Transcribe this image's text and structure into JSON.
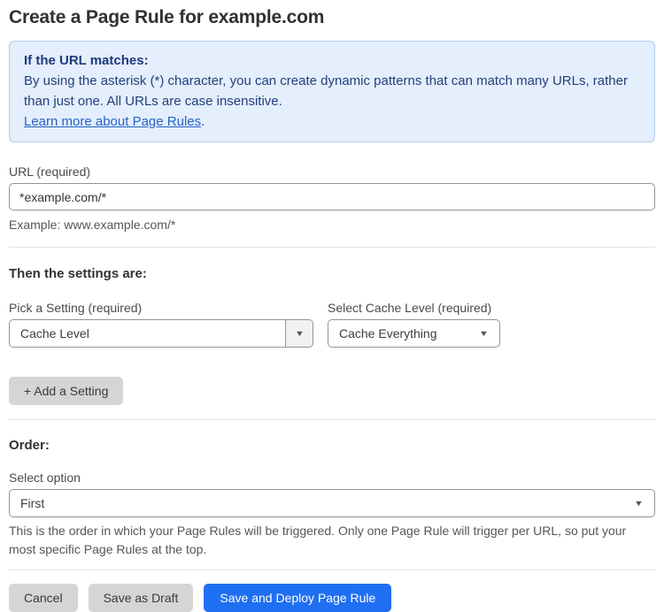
{
  "page": {
    "title": "Create a Page Rule for example.com"
  },
  "info_box": {
    "heading": "If the URL matches:",
    "body": "By using the asterisk (*) character, you can create dynamic patterns that can match many URLs, rather than just one. All URLs are case insensitive.",
    "link_label": "Learn more about Page Rules",
    "link_suffix": "."
  },
  "url_field": {
    "label": "URL (required)",
    "value": "*example.com/*",
    "example": "Example: www.example.com/*"
  },
  "settings_section": {
    "heading": "Then the settings are:",
    "setting_label": "Pick a Setting (required)",
    "setting_value": "Cache Level",
    "cache_level_label": "Select Cache Level (required)",
    "cache_level_value": "Cache Everything",
    "add_setting_button": "+ Add a Setting"
  },
  "order_section": {
    "heading": "Order:",
    "select_label": "Select option",
    "select_value": "First",
    "help_text": "This is the order in which your Page Rules will be triggered. Only one Page Rule will trigger per URL, so put your most specific Page Rules at the top."
  },
  "footer": {
    "cancel_label": "Cancel",
    "save_draft_label": "Save as Draft",
    "save_deploy_label": "Save and Deploy Page Rule"
  },
  "icons": {
    "dropdown_arrow": "▼"
  },
  "colors": {
    "primary_blue": "#1f6ff2",
    "info_background": "#e4eefc",
    "info_border": "#b0cdef",
    "info_text": "#24407c",
    "link_blue": "#2463c6",
    "button_gray": "#d5d5d5"
  }
}
